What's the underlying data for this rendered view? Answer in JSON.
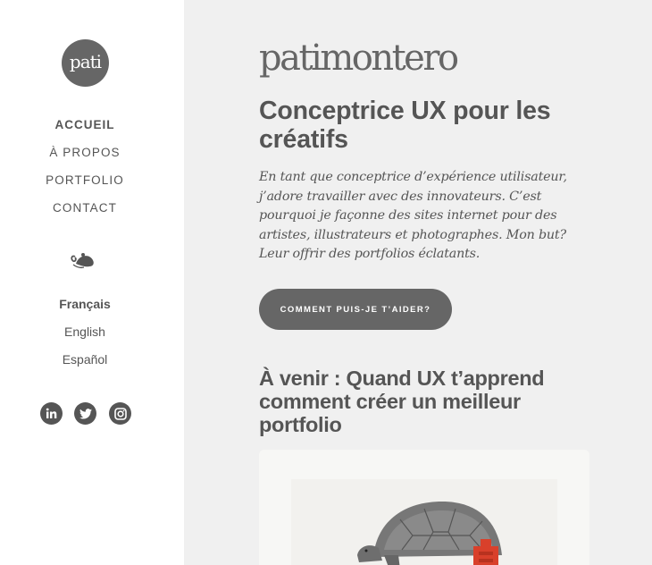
{
  "sidebar": {
    "logo_text": "pati",
    "nav": [
      {
        "label": "ACCUEIL",
        "active": true
      },
      {
        "label": "À PROPOS",
        "active": false
      },
      {
        "label": "PORTFOLIO",
        "active": false
      },
      {
        "label": "CONTACT",
        "active": false
      }
    ],
    "ornament_icon": "fleuron-ornament-icon",
    "languages": [
      {
        "label": "Français",
        "active": true
      },
      {
        "label": "English",
        "active": false
      },
      {
        "label": "Español",
        "active": false
      }
    ],
    "social": [
      {
        "icon": "linkedin-icon"
      },
      {
        "icon": "twitter-icon"
      },
      {
        "icon": "instagram-icon"
      }
    ]
  },
  "main": {
    "brand": "patimontero",
    "headline": "Conceptrice UX pour les créatifs",
    "intro": "En tant que conceptrice d’expérience utilisateur, j’adore travailler avec des innovateurs. C’est pourquoi je façonne des sites internet pour des artistes, illustrateurs et photographes. Mon but? Leur offrir des portfolios éclatants.",
    "cta_label": "COMMENT PUIS-JE T’AIDER?",
    "upcoming_title": "À venir : Quand UX t’apprend comment créer un meilleur portfolio",
    "card_image": "tortoise-illustration"
  },
  "colors": {
    "sidebar_bg": "#ffffff",
    "main_bg": "#f0f0f0",
    "text": "#555555",
    "button_bg": "#666666",
    "accent_red": "#d9402b"
  }
}
